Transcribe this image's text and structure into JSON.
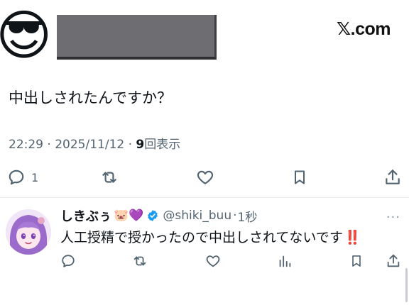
{
  "header": {
    "avatar_emoji": "😎",
    "watermark_x": "𝕏",
    "watermark_domain": ".com"
  },
  "post": {
    "text": "中出しされたんですか？",
    "time": "22:29",
    "date": "2025/11/12",
    "views_count": "9",
    "views_label": "回表示",
    "reply_count": "1"
  },
  "reply": {
    "name": "しきぶぅ",
    "name_emojis": "🐷💜",
    "handle": "@shiki_buu",
    "time": "1秒",
    "more": "···",
    "text": "人工授精で授かったので中出しされてないです",
    "text_emphasis": "‼️"
  },
  "colors": {
    "text": "#0f1419",
    "muted": "#536471",
    "verified": "#1d9bf0",
    "divider": "#e6ecf0"
  }
}
